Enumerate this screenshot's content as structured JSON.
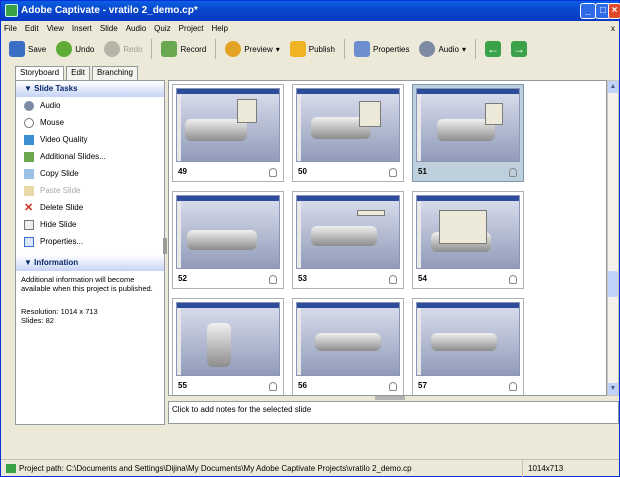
{
  "window": {
    "title": "Adobe Captivate - vratilo 2_demo.cp*"
  },
  "menu": [
    "File",
    "Edit",
    "View",
    "Insert",
    "Slide",
    "Audio",
    "Quiz",
    "Project",
    "Help"
  ],
  "menu_close": "x",
  "toolbar": {
    "save": "Save",
    "undo": "Undo",
    "redo": "Redo",
    "record": "Record",
    "preview": "Preview",
    "publish": "Publish",
    "properties": "Properties",
    "audio": "Audio",
    "preview_arrow": "▾",
    "audio_arrow": "▾"
  },
  "tabs": [
    "Storyboard",
    "Edit",
    "Branching"
  ],
  "slide_tasks": {
    "header": "Slide Tasks",
    "items": [
      "Audio",
      "Mouse",
      "Video Quality",
      "Additional Slides...",
      "Copy Slide",
      "Paste Slide",
      "Delete Slide",
      "Hide Slide",
      "Properties..."
    ]
  },
  "information": {
    "header": "Information",
    "text": "Additional information will become available when this project is published.",
    "resolution": "Resolution: 1014 x 713",
    "slides": "Slides: 82"
  },
  "slides": [
    {
      "num": "49",
      "selected": false
    },
    {
      "num": "50",
      "selected": false
    },
    {
      "num": "51",
      "selected": true
    },
    {
      "num": "52",
      "selected": false
    },
    {
      "num": "53",
      "selected": false
    },
    {
      "num": "54",
      "selected": false
    },
    {
      "num": "55",
      "selected": false
    },
    {
      "num": "56",
      "selected": false
    },
    {
      "num": "57",
      "selected": false
    }
  ],
  "notes": {
    "placeholder": "Click to add notes for the selected slide"
  },
  "status": {
    "path": "Project path: C:\\Documents and Settings\\Dijina\\My Documents\\My Adobe Captivate Projects\\vratilo 2_demo.cp",
    "resolution": "1014x713"
  },
  "colors": {
    "titlebar": "#0846c9",
    "selection": "#bfd0dd",
    "panel_header": "#c6d3f7"
  }
}
